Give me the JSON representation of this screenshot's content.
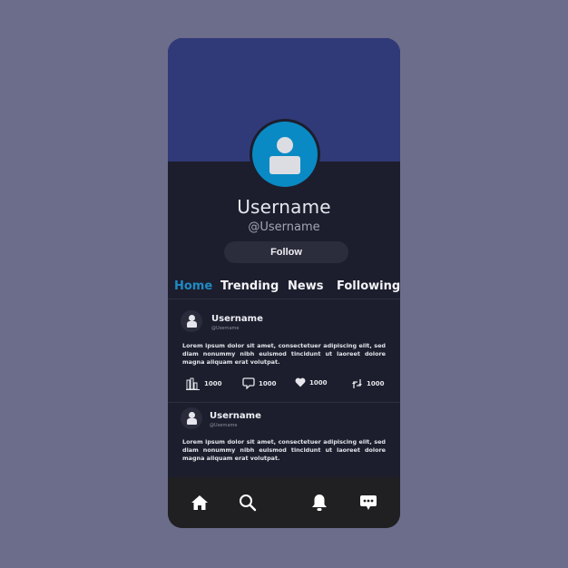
{
  "profile": {
    "name": "Username",
    "handle": "@Username",
    "follow_label": "Follow",
    "avatar_icon": "user-icon"
  },
  "tabs": [
    {
      "label": "Home",
      "active": true
    },
    {
      "label": "Trending",
      "active": false
    },
    {
      "label": "News",
      "active": false
    },
    {
      "label": "Following",
      "active": false
    }
  ],
  "posts": [
    {
      "user": "Username",
      "handle": "@Username",
      "text": "Lorem ipsum dolor sit amet, consectetuer adipiscing elit, sed diam nonummy nibh euismod tincidunt ut laoreet dolore magna aliquam erat volutpat.",
      "stats": {
        "views": "1000",
        "comments": "1000",
        "likes": "1000",
        "reposts": "1000"
      }
    },
    {
      "user": "Username",
      "handle": "@Username",
      "text": "Lorem ipsum dolor sit amet, consectetuer adipiscing elit, sed diam nonummy nibh euismod tincidunt ut laoreet dolore magna aliquam erat volutpat."
    }
  ],
  "bottom_nav": [
    {
      "icon": "home-icon"
    },
    {
      "icon": "search-icon"
    },
    {
      "icon": "bell-icon"
    },
    {
      "icon": "chat-icon"
    }
  ],
  "colors": {
    "background": "#6b6d8a",
    "header": "#313a78",
    "surface": "#1c1e2d",
    "accent": "#1f8ac2",
    "avatar": "#0a8ac4",
    "nav": "#202022"
  }
}
